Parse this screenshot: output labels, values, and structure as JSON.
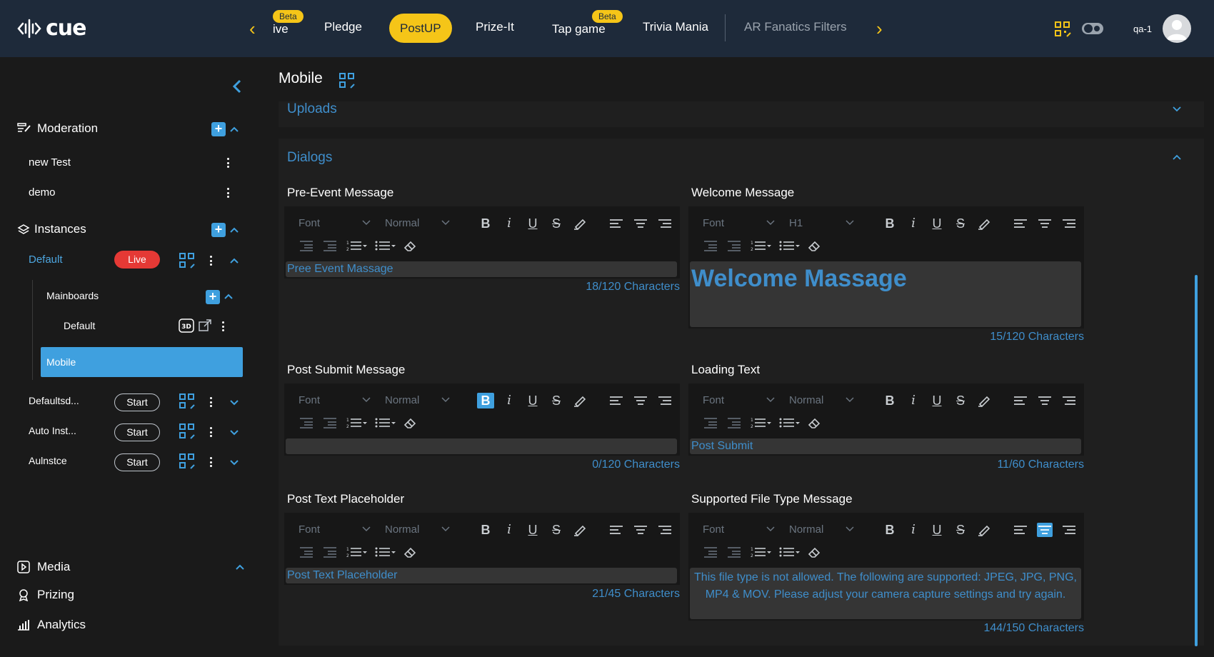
{
  "app": {
    "logo_text": "cue",
    "logo_icon": "soundwave-logo-icon"
  },
  "topnav": {
    "items": [
      {
        "label": "ive",
        "beta": "Beta"
      },
      {
        "label": "Pledge"
      },
      {
        "label": "PostUP",
        "active": true
      },
      {
        "label": "Prize-It"
      },
      {
        "label": "Tap game",
        "beta": "Beta"
      },
      {
        "label": "Trivia Mania"
      },
      {
        "label": "AR Fanatics Filters"
      }
    ],
    "username": "qa-1",
    "icons": [
      "qr-code-icon",
      "toggle-theme-icon",
      "user-avatar-icon"
    ]
  },
  "sidebar": {
    "moderation": {
      "label": "Moderation",
      "items": [
        "new Test",
        "demo"
      ]
    },
    "instances": {
      "label": "Instances",
      "items": [
        {
          "name": "Default",
          "status": "Live",
          "mainboards_label": "Mainboards",
          "mainboard": "Default",
          "selected": "Mobile"
        },
        {
          "name": "Defaultsd...",
          "status": "Start"
        },
        {
          "name": "Auto Inst...",
          "status": "Start"
        },
        {
          "name": "Aulnstce",
          "status": "Start"
        }
      ]
    },
    "bottom": [
      "Media",
      "Prizing",
      "Analytics"
    ]
  },
  "main": {
    "title": "Mobile",
    "uploads_label": "Uploads",
    "dialogs_label": "Dialogs",
    "toolbar": {
      "font": "Font",
      "normal": "Normal",
      "h1": "H1"
    },
    "fields": [
      {
        "label": "Pre-Event Message",
        "value": "Pree Event Massage",
        "counter": "18/120 Characters"
      },
      {
        "label": "Welcome Message",
        "value": "Welcome Massage",
        "counter": "15/120 Characters"
      },
      {
        "label": "Post Submit Message",
        "value": "",
        "counter": "0/120 Characters"
      },
      {
        "label": "Loading Text",
        "value": "Post Submit",
        "counter": "11/60 Characters"
      },
      {
        "label": "Post Text Placeholder",
        "value": "Post Text Placeholder",
        "counter": "21/45 Characters"
      },
      {
        "label": "Supported File Type Message",
        "value": "This file type is not allowed. The following are supported: JPEG, JPG, PNG, MP4 & MOV. Please adjust your camera capture settings and try again.",
        "counter": "144/150 Characters"
      }
    ]
  },
  "colors": {
    "accent": "#3fa0df",
    "brand_yellow": "#f5c518",
    "live_red": "#e53935",
    "topbar": "#1e2a3a"
  }
}
